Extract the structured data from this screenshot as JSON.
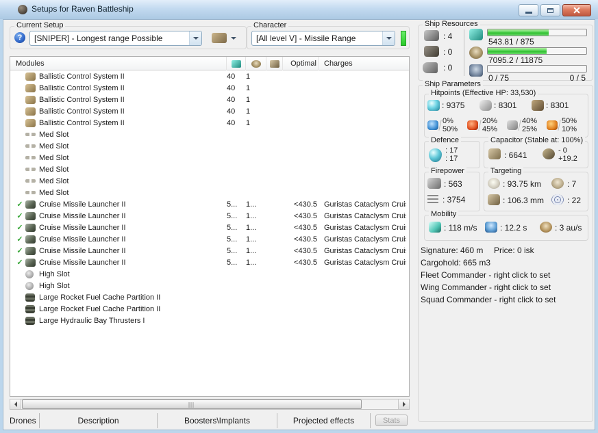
{
  "window": {
    "title": "Setups for Raven Battleship"
  },
  "setup": {
    "label": "Current Setup",
    "value": "[SNIPER] - Longest range Possible",
    "help_glyph": "?"
  },
  "character": {
    "label": "Character",
    "value": "[All level V] - Missile Range"
  },
  "modules": {
    "header": {
      "name": "Modules",
      "optimal": "Optimal",
      "charges": "Charges"
    },
    "rows": [
      {
        "check": "",
        "icon": "bcs",
        "name": "Ballistic Control System II",
        "cpu": "40",
        "pg": "1",
        "optimal": "",
        "charges": ""
      },
      {
        "check": "",
        "icon": "bcs",
        "name": "Ballistic Control System II",
        "cpu": "40",
        "pg": "1",
        "optimal": "",
        "charges": ""
      },
      {
        "check": "",
        "icon": "bcs",
        "name": "Ballistic Control System II",
        "cpu": "40",
        "pg": "1",
        "optimal": "",
        "charges": ""
      },
      {
        "check": "",
        "icon": "bcs",
        "name": "Ballistic Control System II",
        "cpu": "40",
        "pg": "1",
        "optimal": "",
        "charges": ""
      },
      {
        "check": "",
        "icon": "bcs",
        "name": "Ballistic Control System II",
        "cpu": "40",
        "pg": "1",
        "optimal": "",
        "charges": ""
      },
      {
        "check": "",
        "icon": "medslot",
        "name": "Med Slot",
        "cpu": "",
        "pg": "",
        "optimal": "",
        "charges": ""
      },
      {
        "check": "",
        "icon": "medslot",
        "name": "Med Slot",
        "cpu": "",
        "pg": "",
        "optimal": "",
        "charges": ""
      },
      {
        "check": "",
        "icon": "medslot",
        "name": "Med Slot",
        "cpu": "",
        "pg": "",
        "optimal": "",
        "charges": ""
      },
      {
        "check": "",
        "icon": "medslot",
        "name": "Med Slot",
        "cpu": "",
        "pg": "",
        "optimal": "",
        "charges": ""
      },
      {
        "check": "",
        "icon": "medslot",
        "name": "Med Slot",
        "cpu": "",
        "pg": "",
        "optimal": "",
        "charges": ""
      },
      {
        "check": "",
        "icon": "medslot",
        "name": "Med Slot",
        "cpu": "",
        "pg": "",
        "optimal": "",
        "charges": ""
      },
      {
        "check": "✓",
        "icon": "launcher",
        "name": "Cruise Missile Launcher II",
        "cpu": "5...",
        "pg": "1...",
        "optimal": "<430.5",
        "charges": "Guristas Cataclysm Cruise"
      },
      {
        "check": "✓",
        "icon": "launcher",
        "name": "Cruise Missile Launcher II",
        "cpu": "5...",
        "pg": "1...",
        "optimal": "<430.5",
        "charges": "Guristas Cataclysm Cruise"
      },
      {
        "check": "✓",
        "icon": "launcher",
        "name": "Cruise Missile Launcher II",
        "cpu": "5...",
        "pg": "1...",
        "optimal": "<430.5",
        "charges": "Guristas Cataclysm Cruise"
      },
      {
        "check": "✓",
        "icon": "launcher",
        "name": "Cruise Missile Launcher II",
        "cpu": "5...",
        "pg": "1...",
        "optimal": "<430.5",
        "charges": "Guristas Cataclysm Cruise"
      },
      {
        "check": "✓",
        "icon": "launcher",
        "name": "Cruise Missile Launcher II",
        "cpu": "5...",
        "pg": "1...",
        "optimal": "<430.5",
        "charges": "Guristas Cataclysm Cruise"
      },
      {
        "check": "✓",
        "icon": "launcher",
        "name": "Cruise Missile Launcher II",
        "cpu": "5...",
        "pg": "1...",
        "optimal": "<430.5",
        "charges": "Guristas Cataclysm Cruise"
      },
      {
        "check": "",
        "icon": "highslot",
        "name": "High Slot",
        "cpu": "",
        "pg": "",
        "optimal": "",
        "charges": ""
      },
      {
        "check": "",
        "icon": "highslot",
        "name": "High Slot",
        "cpu": "",
        "pg": "",
        "optimal": "",
        "charges": ""
      },
      {
        "check": "",
        "icon": "rig",
        "name": "Large Rocket Fuel Cache Partition II",
        "cpu": "",
        "pg": "",
        "optimal": "",
        "charges": ""
      },
      {
        "check": "",
        "icon": "rig",
        "name": "Large Rocket Fuel Cache Partition II",
        "cpu": "",
        "pg": "",
        "optimal": "",
        "charges": ""
      },
      {
        "check": "",
        "icon": "rig",
        "name": "Large Hydraulic Bay Thrusters I",
        "cpu": "",
        "pg": "",
        "optimal": "",
        "charges": ""
      }
    ]
  },
  "tabs": [
    {
      "label": "Drones"
    },
    {
      "label": "Description"
    },
    {
      "label": "Boosters\\Implants"
    },
    {
      "label": "Projected effects"
    }
  ],
  "stats_button": {
    "label": "Stats"
  },
  "ship_resources": {
    "label": "Ship Resources",
    "turrets": ": 4",
    "launchers": ": 0",
    "rigs": ": 0",
    "cpu": {
      "text": "543.81 / 875",
      "pct": 62
    },
    "powergrid": {
      "text": "7095.2 / 11875",
      "pct": 60
    },
    "drones": {
      "text": "0 / 75",
      "right": "0 / 5",
      "pct": 0
    }
  },
  "ship_parameters": {
    "label": "Ship Parameters",
    "hitpoints": {
      "label": "Hitpoints (Effective HP: 33,530)",
      "shield": ": 9375",
      "armor": ": 8301",
      "hull": ": 8301",
      "resists": [
        {
          "icon": "em",
          "top": "0%",
          "bottom": "50%"
        },
        {
          "icon": "thermal",
          "top": "20%",
          "bottom": "45%"
        },
        {
          "icon": "kinetic",
          "top": "40%",
          "bottom": "25%"
        },
        {
          "icon": "explosive",
          "top": "50%",
          "bottom": "10%"
        }
      ]
    },
    "defence": {
      "label": "Defence",
      "line1": ": 17",
      "line2": ": 17"
    },
    "capacitor": {
      "label": "Capacitor (Stable at: 100%)",
      "amount": ": 6641",
      "delta_top": "- 0",
      "delta_bottom": "+19.2"
    },
    "firepower": {
      "label": "Firepower",
      "dps": ": 563",
      "volley": ": 3754"
    },
    "targeting": {
      "label": "Targeting",
      "range": ": 93.75 km",
      "max_targets": ": 7",
      "sensor": ": 106.3 mm",
      "scan_res": ": 22"
    },
    "mobility": {
      "label": "Mobility",
      "speed": ": 118 m/s",
      "align": ": 12.2 s",
      "warp": ": 3 au/s"
    },
    "info": {
      "signature": "Signature: 460 m",
      "price": "Price: 0 isk",
      "cargohold": "Cargohold: 665 m3",
      "fleet": "Fleet Commander - right click to set",
      "wing": "Wing Commander - right click to set",
      "squad": "Squad Commander - right click to set"
    }
  }
}
